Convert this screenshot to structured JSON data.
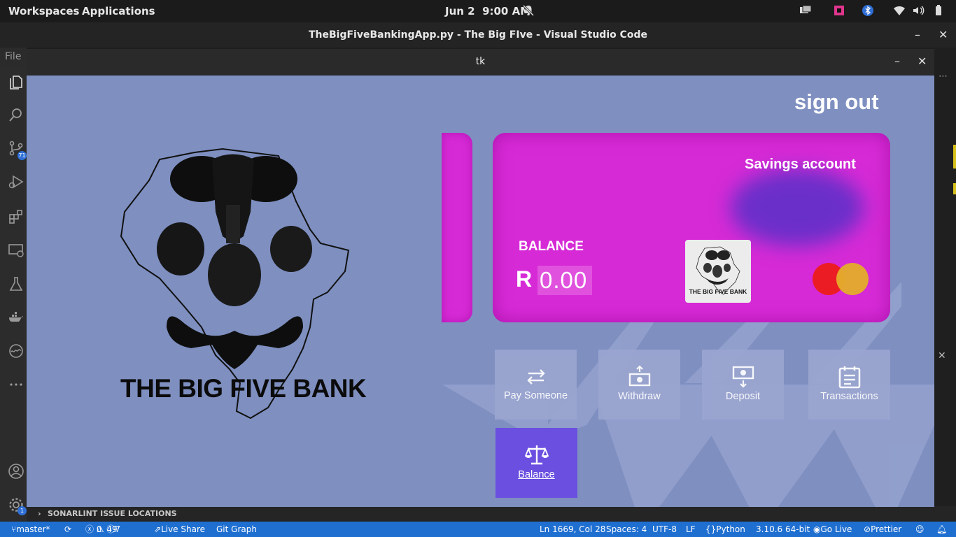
{
  "system": {
    "workspaces": "Workspaces",
    "applications": "Applications",
    "date": "Jun 2",
    "time": "9:00 AM"
  },
  "vscode": {
    "title": "TheBigFiveBankingApp.py - The Big FIve - Visual Studio Code",
    "menu_file": "File",
    "badge_scm": "71",
    "badge_settings": "1",
    "sonar_panel": "SONARLINT ISSUE LOCATIONS",
    "status": {
      "branch": "master*",
      "errors": "0",
      "warnings": "49",
      "infos": "7",
      "live_share": "Live Share",
      "git_graph": "Git Graph",
      "position": "Ln 1669, Col 28",
      "spaces": "Spaces: 4",
      "encoding": "UTF-8",
      "eol": "LF",
      "language": "Python",
      "interpreter": "3.10.6 64-bit",
      "go_live": "Go Live",
      "prettier": "Prettier"
    }
  },
  "tk": {
    "title": "tk",
    "sign_out": "sign out",
    "bank_name": "THE BIG FIVE BANK",
    "card": {
      "account_type": "Savings account",
      "balance_label": "BALANCE",
      "currency": "R",
      "amount": "0.00",
      "logo_text": "THE BIG FIVE BANK"
    },
    "actions": [
      "Pay Someone",
      "Withdraw",
      "Deposit",
      "Transactions",
      "Balance"
    ]
  },
  "colors": {
    "app_background": "#7e8fc0",
    "card": "#d62ad6",
    "tile": "#9aa5d0",
    "active_tile": "#6a4fe0",
    "status_bar": "#1f6fd1"
  }
}
